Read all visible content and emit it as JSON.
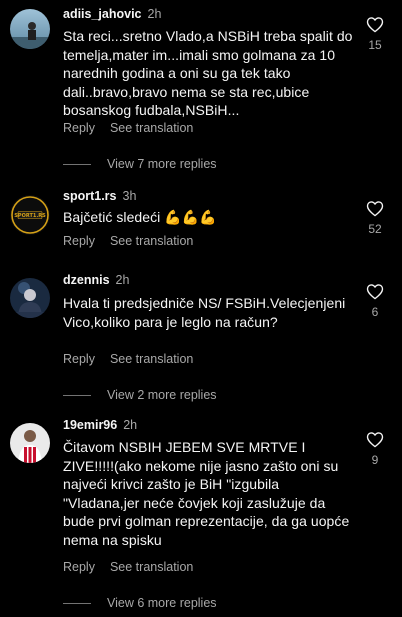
{
  "comments": [
    {
      "username": "adiis_jahovic",
      "time": "2h",
      "text": "Sta reci...sretno Vlado,a NSBiH treba spalit do temelja,mater im...imali smo golmana za 10 narednih godina a oni su ga tek tako dali..bravo,bravo nema se sta rec,ubice bosanskog fudbala,NSBiH...",
      "reply": "Reply",
      "see_translation": "See translation",
      "likes": "15",
      "view_replies": "View 7 more replies"
    },
    {
      "username": "sport1.rs",
      "time": "3h",
      "text": "Bajčetić sledeći 💪💪💪",
      "reply": "Reply",
      "see_translation": "See translation",
      "likes": "52",
      "avatar_text": "SPORT1.RS"
    },
    {
      "username": "dzennis",
      "time": "2h",
      "text": "Hvala ti predsjedniče NS/ FSBiH.Velecjenjeni Vico,koliko para je leglo na račun?",
      "reply": "Reply",
      "see_translation": "See translation",
      "likes": "6",
      "view_replies": "View 2 more replies"
    },
    {
      "username": "19emir96",
      "time": "2h",
      "text": "Čitavom NSBIH JEBEM SVE MRTVE I ZIVE!!!!!(ako nekome nije jasno zašto oni su najveći krivci zašto je BiH \"izgubila \"Vladana,jer neće čovjek koji zaslužuje da bude prvi golman reprezentacije, da ga uopće nema na spisku",
      "reply": "Reply",
      "see_translation": "See translation",
      "likes": "9",
      "view_replies": "View 6 more replies"
    }
  ],
  "colors": {
    "background": "#000000",
    "text": "#f5f5f5",
    "secondary": "#a8a8a8",
    "sport1_brand": "#d4a017"
  },
  "icons": {
    "like": "heart-outline-icon"
  }
}
